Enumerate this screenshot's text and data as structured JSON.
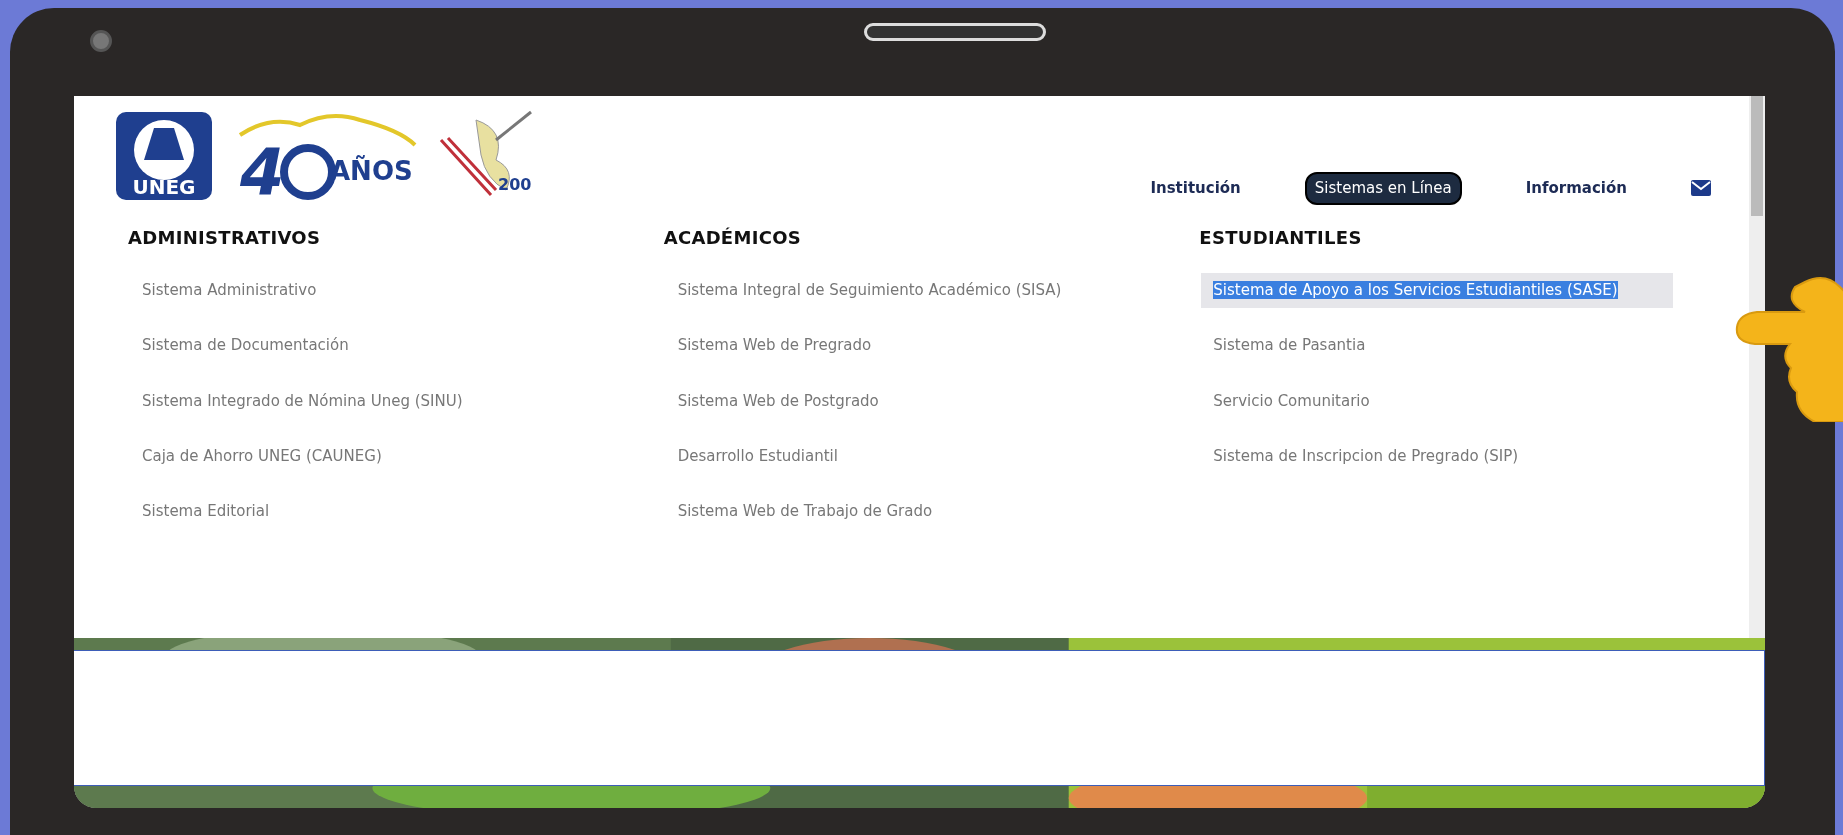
{
  "logos": [
    {
      "kind": "uneg",
      "text": "UNEG"
    },
    {
      "kind": "anniversary",
      "number": "4",
      "text": "AÑOS"
    },
    {
      "kind": "bicentennial",
      "text": "200"
    }
  ],
  "nav": [
    {
      "label": "Institución",
      "selected": false
    },
    {
      "label": "Sistemas en Línea",
      "selected": true
    },
    {
      "label": "Información",
      "selected": false
    }
  ],
  "columns": [
    {
      "heading": "ADMINISTRATIVOS",
      "items": [
        {
          "label": "Sistema Administrativo",
          "selected": false
        },
        {
          "label": "Sistema de Documentación",
          "selected": false
        },
        {
          "label": "Sistema Integrado de Nómina Uneg (SINU)",
          "selected": false
        },
        {
          "label": "Caja de Ahorro UNEG (CAUNEG)",
          "selected": false
        },
        {
          "label": "Sistema Editorial",
          "selected": false
        }
      ]
    },
    {
      "heading": "ACADÉMICOS",
      "items": [
        {
          "label": "Sistema Integral de Seguimiento Académico (SISA)",
          "selected": false
        },
        {
          "label": "Sistema Web de Pregrado",
          "selected": false
        },
        {
          "label": "Sistema Web de Postgrado",
          "selected": false
        },
        {
          "label": "Desarrollo Estudiantil",
          "selected": false
        },
        {
          "label": "Sistema Web de Trabajo de Grado",
          "selected": false
        }
      ]
    },
    {
      "heading": "ESTUDIANTILES",
      "items": [
        {
          "label": "Sistema de Apoyo a los Servicios Estudiantiles (SASE)",
          "selected": true
        },
        {
          "label": "Sistema de Pasantia",
          "selected": false
        },
        {
          "label": "Servicio Comunitario",
          "selected": false
        },
        {
          "label": "Sistema de Inscripcion de Pregrado (SIP)",
          "selected": false
        }
      ]
    }
  ]
}
